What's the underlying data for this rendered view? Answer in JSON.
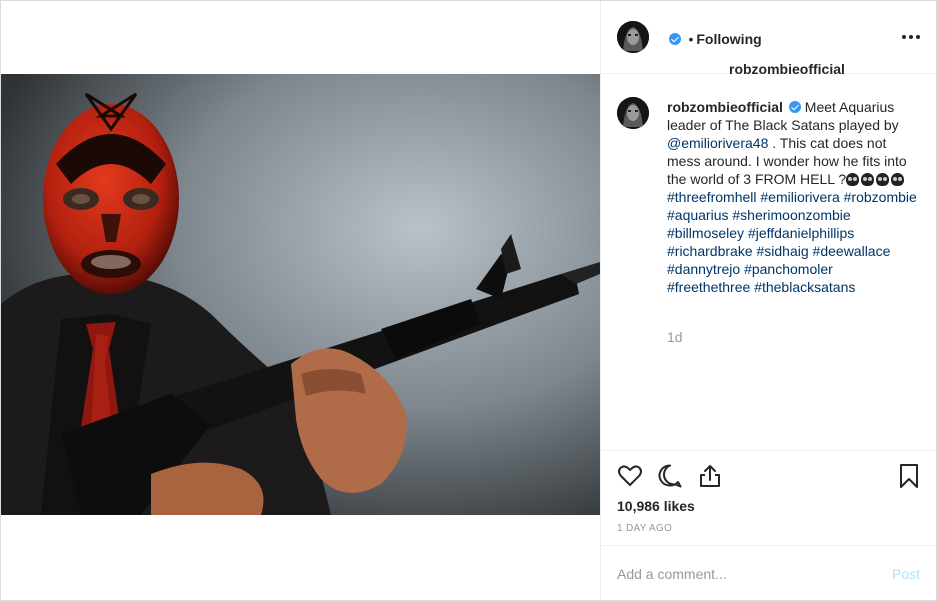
{
  "post": {
    "username": "robzombieofficial",
    "follow_status": "Following",
    "separator": "•",
    "caption_text_1": "Meet Aquarius leader of The Black Satans played by ",
    "mention": "@emiliorivera48",
    "caption_text_2": " . This cat does not mess around. I wonder how he fits into the world of 3 FROM HELL ?",
    "hashtags": [
      "#threefromhell",
      "#emiliorivera",
      "#robzombie",
      "#aquarius",
      "#sherimoonzombie",
      "#billmoseley",
      "#jeffdanielphillips",
      "#richardbrake",
      "#sidhaig",
      "#deewallace",
      "#dannytrejo",
      "#panchomoler",
      "#freethethree",
      "#theblacksatans"
    ],
    "time_ago": "1d",
    "likes": "10,986 likes",
    "date": "1 DAY AGO"
  },
  "comment": {
    "placeholder": "Add a comment...",
    "post_label": "Post"
  },
  "icons": {
    "verified": "verified-badge-icon",
    "more": "more-options-icon",
    "like": "heart-icon",
    "comment": "comment-bubble-icon",
    "share": "share-icon",
    "save": "bookmark-icon"
  },
  "colors": {
    "link": "#003569",
    "verified": "#3897f0",
    "post_disabled": "#b2dffc"
  }
}
